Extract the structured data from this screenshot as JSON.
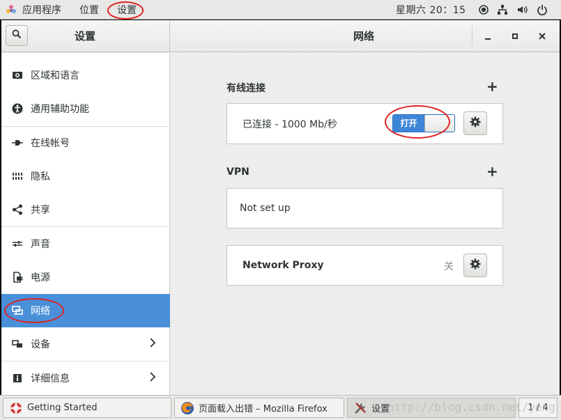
{
  "topbar": {
    "apps": "应用程序",
    "places": "位置",
    "settings": "设置",
    "clock": "星期六 20：15"
  },
  "window": {
    "sidebar_title": "设置",
    "panel_title": "网络",
    "minimize": "_",
    "maximize": "▫",
    "close": "✕"
  },
  "sidebar": {
    "items": [
      {
        "label": "区域和语言",
        "icon": "region-icon"
      },
      {
        "label": "通用辅助功能",
        "icon": "accessibility-icon"
      },
      {
        "label": "在线帐号",
        "icon": "online-accounts-icon"
      },
      {
        "label": "隐私",
        "icon": "privacy-icon"
      },
      {
        "label": "共享",
        "icon": "share-icon"
      },
      {
        "label": "声音",
        "icon": "sound-icon"
      },
      {
        "label": "电源",
        "icon": "power-icon"
      },
      {
        "label": "网络",
        "icon": "network-icon",
        "selected": true
      },
      {
        "label": "设备",
        "icon": "devices-icon",
        "chevron": "›"
      },
      {
        "label": "详细信息",
        "icon": "details-icon",
        "chevron": "›"
      }
    ]
  },
  "network": {
    "wired": {
      "title": "有线连接",
      "add": "+",
      "status": "已连接 - 1000 Mb/秒",
      "switch_label": "打开"
    },
    "vpn": {
      "title": "VPN",
      "add": "+",
      "empty": "Not set up"
    },
    "proxy": {
      "label": "Network Proxy",
      "status": "关"
    }
  },
  "taskbar": {
    "tasks": [
      {
        "label": "Getting Started",
        "icon": "help-lifebuoy-icon"
      },
      {
        "label": "页面载入出错 – Mozilla Firefox",
        "icon": "firefox-icon"
      },
      {
        "label": "设置",
        "icon": "settings-tools-icon"
      }
    ],
    "pager": "1 / 4"
  },
  "watermark": "http://blog.csdn.net/yeng",
  "colors": {
    "accent": "#4a90d9",
    "switch_on": "#3d86d8",
    "annotation": "#e0221f"
  }
}
